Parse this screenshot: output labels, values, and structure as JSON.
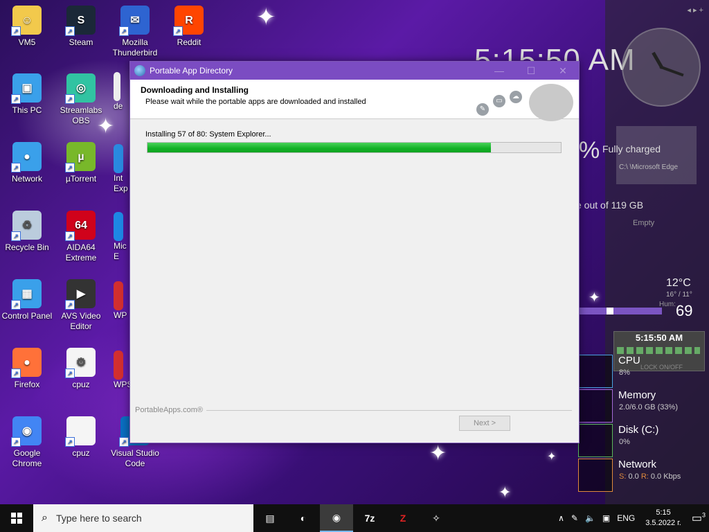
{
  "desktop": {
    "icons": [
      {
        "label": "VM5",
        "glyph": "☺",
        "color": "#f2c94c"
      },
      {
        "label": "Steam",
        "glyph": "S",
        "color": "#1b2838"
      },
      {
        "label": "Mozilla Thunderbird",
        "glyph": "✉",
        "color": "#2e64d1"
      },
      {
        "label": "Reddit",
        "glyph": "R",
        "color": "#ff4500"
      },
      {
        "label": "This PC",
        "glyph": "▣",
        "color": "#3aa0ea"
      },
      {
        "label": "Streamlabs OBS",
        "glyph": "◎",
        "color": "#31c3a2"
      },
      {
        "label": "Network",
        "glyph": "●",
        "color": "#3aa0ea"
      },
      {
        "label": "µTorrent",
        "glyph": "µ",
        "color": "#78b82a"
      },
      {
        "label": "Recycle Bin",
        "glyph": "♻",
        "color": "#bcd"
      },
      {
        "label": "AIDA64 Extreme",
        "glyph": "64",
        "color": "#d0021b"
      },
      {
        "label": "Control Panel",
        "glyph": "▦",
        "color": "#3aa0ea"
      },
      {
        "label": "AVS Video Editor",
        "glyph": "▶",
        "color": "#333"
      },
      {
        "label": "Firefox",
        "glyph": "●",
        "color": "#ff7139"
      },
      {
        "label": "cpuz",
        "glyph": "⚙",
        "color": "#f5f5f5"
      },
      {
        "label": "Google Chrome",
        "glyph": "◉",
        "color": "#4285f4"
      },
      {
        "label": "cpuz",
        "glyph": "",
        "color": "#f5f5f5"
      },
      {
        "label": "Visual Studio Code",
        "glyph": "❯",
        "color": "#0a6fc2"
      }
    ],
    "partial_labels": [
      "de",
      "Int Exp",
      "Mic E",
      "WP",
      "WPS"
    ]
  },
  "dialog": {
    "title": "Portable App Directory",
    "heading": "Downloading and Installing",
    "subheading": "Please wait while the portable apps are downloaded and installed",
    "status": "Installing 57 of 80: System Explorer...",
    "progress": 0.83,
    "brand": "PortableApps.com®",
    "next_label": "Next >",
    "close_glyph": "✕",
    "min_glyph": "—",
    "max_glyph": "☐"
  },
  "widgets": {
    "clock_big": "5:15:50 AM",
    "battery_text": "Fully charged",
    "battery_pct_partial": "%",
    "disk_text": "e out of 119 GB",
    "edge_text": "C:\\ \\Microsoft Edge",
    "empty_text": "Empty",
    "temp": "12°C",
    "temp_range": "16° / 11°",
    "temp_sub": "Hum:",
    "volume": "69",
    "clock_small": "5:15:50 AM",
    "lock_text": "LOCK ON/OFF",
    "nav_arrows": "◂ ▸ +"
  },
  "perf": [
    {
      "name": "CPU",
      "value": "8%"
    },
    {
      "name": "Memory",
      "value": "2.0/6.0 GB (33%)"
    },
    {
      "name": "Disk (C:)",
      "value": "0%"
    },
    {
      "name": "Network",
      "value_s": "S:",
      "value_sv": " 0.0 ",
      "value_r": "R:",
      "value_rv": " 0.0 Kbps"
    }
  ],
  "taskbar": {
    "search_placeholder": "Type here to search",
    "apps": [
      "▤",
      "◐",
      "◉",
      "7z",
      "Z",
      "✧"
    ],
    "tray_chevron": "∧",
    "lang": "ENG",
    "time": "5:15",
    "date": "3.5.2022 г.",
    "notifications": "3"
  }
}
